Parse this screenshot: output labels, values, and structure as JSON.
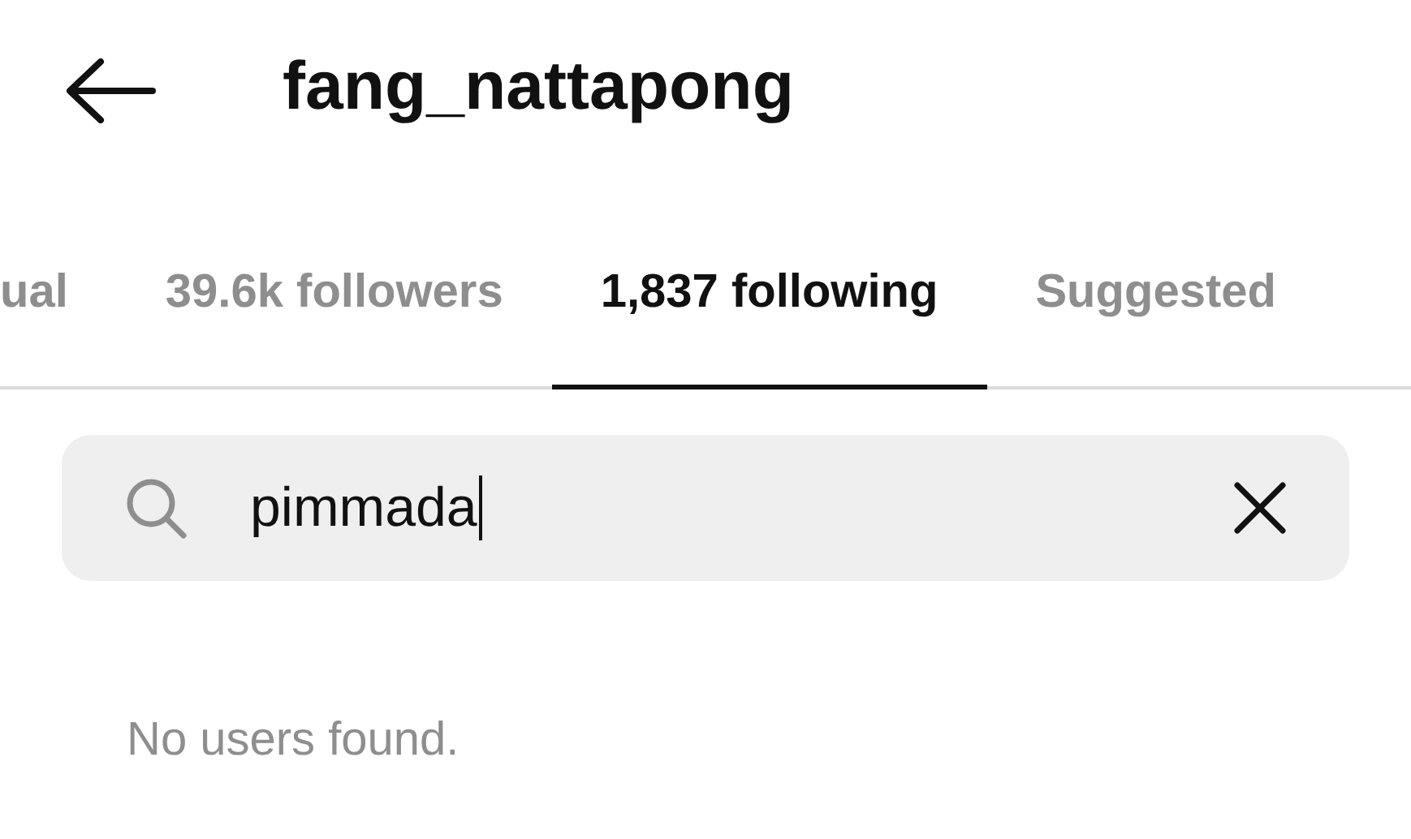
{
  "header": {
    "title": "fang_nattapong"
  },
  "tabs": [
    {
      "label": "ual",
      "selected": false
    },
    {
      "label": "39.6k followers",
      "selected": false
    },
    {
      "label": "1,837 following",
      "selected": true
    },
    {
      "label": "Suggested",
      "selected": false
    }
  ],
  "search": {
    "value": "pimmada"
  },
  "empty_message": "No users found."
}
